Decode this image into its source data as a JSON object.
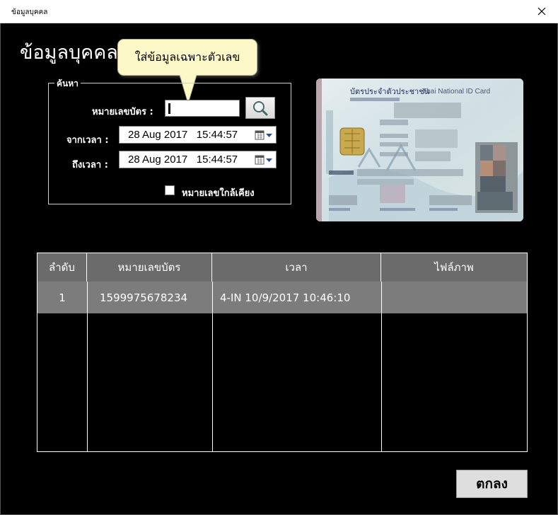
{
  "window": {
    "title": "ข้อมูลบุคคล",
    "close_icon": "close-icon"
  },
  "heading": "ข้อมูลบุคคล",
  "tooltip": "ใส่ข้อมูลเฉพาะตัวเลข",
  "search": {
    "legend": "ค้นหา",
    "card_no_label": "หมายเลขบัตร :",
    "card_no_value": "",
    "from_label": "จากเวลา :",
    "from_value": "28 Aug 2017   15:44:57",
    "to_label": "ถึงเวลา :",
    "to_value": "28 Aug 2017   15:44:57",
    "similar_label": "หมายเลขใกล้เคียง",
    "similar_checked": false
  },
  "id_card": {
    "title_th": "บัตรประจำตัวประชาชน",
    "title_en": "Thai National ID Card"
  },
  "table": {
    "columns": [
      "ลำดับ",
      "หมายเลขบัตร",
      "เวลา",
      "ไฟล์ภาพ"
    ],
    "rows": [
      {
        "seq": "1",
        "card_no": "1599975678234",
        "time": "4-IN 10/9/2017 10:46:10",
        "image": ""
      }
    ]
  },
  "ok_button": "ตกลง"
}
